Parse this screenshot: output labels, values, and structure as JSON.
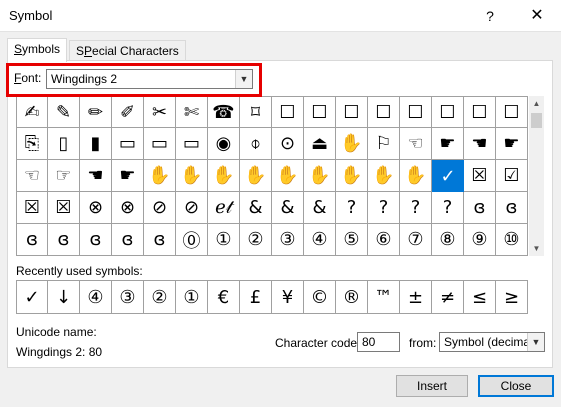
{
  "window": {
    "title": "Symbol",
    "help": "?",
    "close": "✕"
  },
  "tabs": [
    {
      "label": "Symbols",
      "accel": "S",
      "rest": "ymbols"
    },
    {
      "label": "Special Characters",
      "accel": "P",
      "pre": "S",
      "rest": "ecial Characters"
    }
  ],
  "font": {
    "label_accel": "F",
    "label_rest": "ont:",
    "value": "Wingdings 2"
  },
  "grid_symbols": [
    "✍",
    "✎",
    "✏",
    "✐",
    "✂",
    "✄",
    "☎",
    "⌑",
    "☐",
    "☐",
    "☐",
    "☐",
    "☐",
    "☐",
    "☐",
    "☐",
    "⎘",
    "▯",
    "▮",
    "▭",
    "▭",
    "▭",
    "◉",
    "⌽",
    "⊙",
    "⏏",
    "✋",
    "⚐",
    "☜",
    "☛",
    "☚",
    "☛",
    "☜",
    "☞",
    "☚",
    "☛",
    "✋",
    "✋",
    "✋",
    "✋",
    "✋",
    "✋",
    "✋",
    "✋",
    "✋",
    "✓",
    "☒",
    "☑",
    "☒",
    "☒",
    "⊗",
    "⊗",
    "⊘",
    "⊘",
    "ℯ𝓉",
    "&",
    "&",
    "&",
    "?",
    "?",
    "?",
    "?",
    "ɞ",
    "ɞ",
    "ɞ",
    "ɞ",
    "ɞ",
    "ɞ",
    "ɞ",
    "⓪",
    "①",
    "②",
    "③",
    "④",
    "⑤",
    "⑥",
    "⑦",
    "⑧",
    "⑨",
    "⑩"
  ],
  "selected_index": 45,
  "recent_label": "Recently used symbols:",
  "recent_symbols": [
    "✓",
    "↓",
    "④",
    "③",
    "②",
    "①",
    "€",
    "£",
    "¥",
    "©",
    "®",
    "™",
    "±",
    "≠",
    "≤",
    "≥"
  ],
  "recent_tail": "÷",
  "unicode": {
    "label": "Unicode name:",
    "value": "Wingdings 2: 80"
  },
  "char_code": {
    "label_pre": "Character code:",
    "value": "80"
  },
  "from": {
    "label": "from:",
    "value": "Symbol (decimal)"
  },
  "buttons": {
    "insert": "Insert",
    "close": "Close"
  }
}
